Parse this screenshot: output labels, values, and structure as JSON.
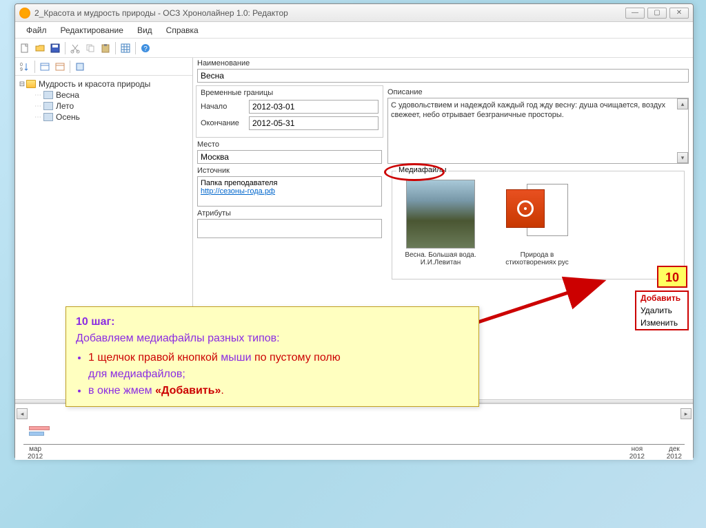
{
  "window": {
    "title": "2_Красота и мудрость природы - ОСЗ Хронолайнер 1.0: Редактор",
    "buttons": {
      "min": "—",
      "max": "▢",
      "close": "✕"
    }
  },
  "menu": {
    "file": "Файл",
    "edit": "Редактирование",
    "view": "Вид",
    "help": "Справка"
  },
  "tree": {
    "root": "Мудрость и красота природы",
    "items": [
      "Весна",
      "Лето",
      "Осень"
    ]
  },
  "form": {
    "name_label": "Наименование",
    "name_value": "Весна",
    "time_label": "Временные границы",
    "start_label": "Начало",
    "start_value": "2012-03-01",
    "end_label": "Окончание",
    "end_value": "2012-05-31",
    "place_label": "Место",
    "place_value": "Москва",
    "source_label": "Источник",
    "source_text": "Папка преподавателя",
    "source_url": "http://сезоны-года.рф",
    "attr_label": "Атрибуты",
    "desc_label": "Описание",
    "desc_text": "С удовольствием и надеждой каждый год жду весну: душа очищается, воздух свежеет, небо отрывает безграничные просторы.",
    "media_label": "Медиафайлы",
    "media1_caption": "Весна. Большая вода. И.И.Левитан",
    "media2_caption": "Природа в стихотворениях рус"
  },
  "context": {
    "badge": "10",
    "add": "Добавить",
    "del": "Удалить",
    "edit": "Изменить"
  },
  "callout": {
    "title": "10 шаг",
    "line1": "Добавляем медиафайлы разных типов:",
    "b1a": "1 щелчок правой кнопкой",
    "b1b": " мыши ",
    "b1c": "по пустому полю",
    "b1d": "для медиафайлов;",
    "b2a": "в окне жмем ",
    "b2b": "«Добавить»",
    "b2c": "."
  },
  "timeline": {
    "t1m": "мар",
    "t1y": "2012",
    "t2m": "ноя",
    "t2y": "2012",
    "t3m": "дек",
    "t3y": "2012"
  }
}
